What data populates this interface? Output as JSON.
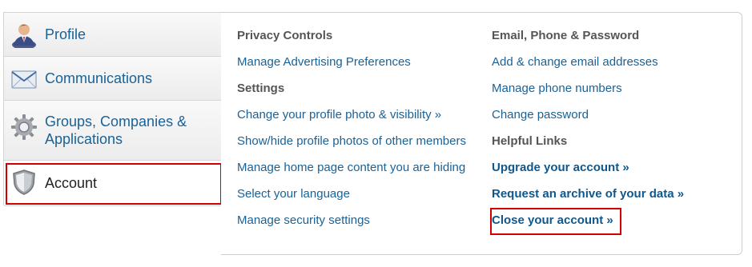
{
  "sidebar": {
    "items": [
      {
        "label": "Profile",
        "icon": "person-icon"
      },
      {
        "label": "Communications",
        "icon": "envelope-icon"
      },
      {
        "label": "Groups, Companies & Applications",
        "icon": "gear-icon"
      },
      {
        "label": "Account",
        "icon": "shield-icon",
        "selected": true
      }
    ]
  },
  "content": {
    "left": {
      "privacy_heading": "Privacy Controls",
      "advertising_link": "Manage Advertising Preferences",
      "settings_heading": "Settings",
      "profile_photo_link": "Change your profile photo & visibility »",
      "show_hide_link": "Show/hide profile photos of other members",
      "homepage_link": "Manage home page content you are hiding",
      "language_link": "Select your language",
      "security_link": "Manage security settings"
    },
    "right": {
      "email_heading": "Email, Phone & Password",
      "email_link": "Add & change email addresses",
      "phone_link": "Manage phone numbers",
      "password_link": "Change password",
      "helpful_heading": "Helpful Links",
      "upgrade_link": "Upgrade your account »",
      "archive_link": "Request an archive of your data »",
      "close_link": "Close your account »"
    }
  },
  "colors": {
    "link": "#1a6296",
    "heading": "#555555",
    "highlight": "#d00000"
  }
}
